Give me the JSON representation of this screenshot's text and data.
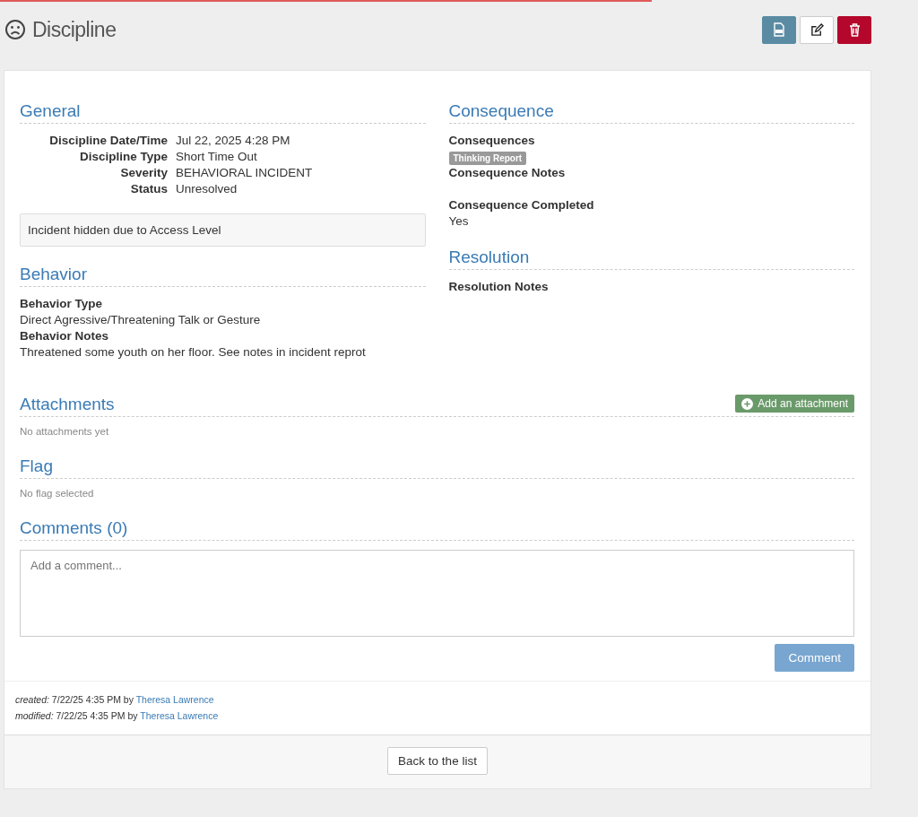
{
  "loading_bar": {
    "level": 0.71
  },
  "page": {
    "title": "Discipline"
  },
  "toolbar": [
    {
      "kind": "pdf"
    },
    {
      "kind": "edit"
    },
    {
      "kind": "delete"
    }
  ],
  "general": {
    "heading": "General",
    "fields": [
      {
        "label": "Discipline Date/Time",
        "value": "Jul 22, 2025 4:28 PM"
      },
      {
        "label": "Discipline Type",
        "value": "Short Time Out"
      },
      {
        "label": "Severity",
        "value": "BEHAVIORAL INCIDENT"
      },
      {
        "label": "Status",
        "value": "Unresolved"
      }
    ],
    "notice": "Incident hidden due to Access Level"
  },
  "behavior": {
    "heading": "Behavior",
    "fields": [
      {
        "label": "Behavior Type",
        "value": "Direct Agressive/Threatening Talk or Gesture"
      },
      {
        "label": "Behavior Notes",
        "value": "Threatened some youth on her floor.  See notes in incident reprot"
      }
    ]
  },
  "consequence": {
    "heading": "Consequence",
    "fields": [
      {
        "label": "Consequences",
        "tags": [
          "Thinking Report"
        ]
      },
      {
        "label": "Consequence Notes"
      },
      {
        "label": "Consequence Completed",
        "value": "Yes"
      }
    ]
  },
  "resolution": {
    "heading": "Resolution",
    "fields": [
      {
        "label": "Resolution Notes"
      }
    ]
  },
  "attachments": {
    "heading": "Attachments",
    "add_button": "Add an attachment",
    "empty": "No attachments yet"
  },
  "flag": {
    "heading": "Flag",
    "empty": "No flag selected"
  },
  "comments": {
    "heading": "Comments (0)",
    "placeholder": "Add a comment...",
    "button": "Comment"
  },
  "audit": [
    {
      "label": "created:",
      "text": "7/22/25 4:35 PM by",
      "user": "Theresa Lawrence"
    },
    {
      "label": "modified:",
      "text": "7/22/25 4:35 PM by",
      "user": "Theresa Lawrence"
    }
  ],
  "back_button": "Back to the list"
}
